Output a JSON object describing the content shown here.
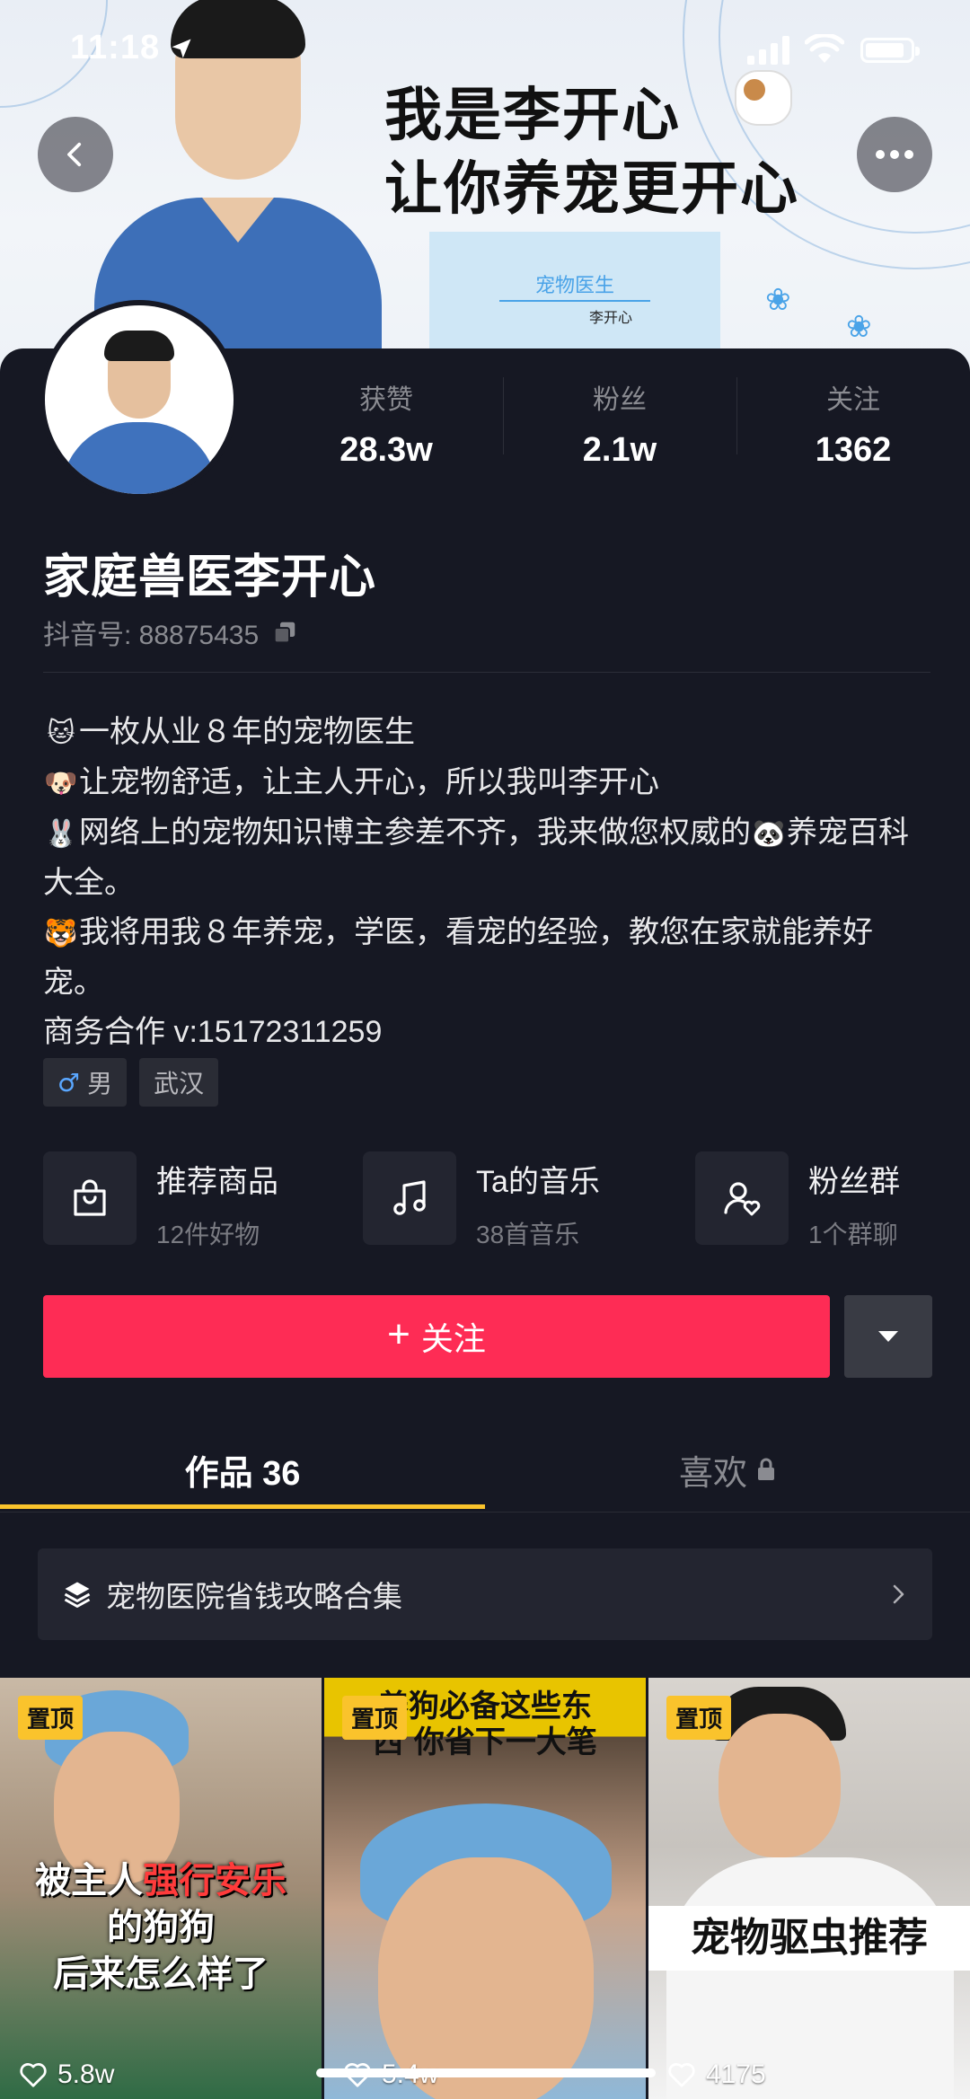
{
  "status_bar": {
    "time": "11:18"
  },
  "banner": {
    "line1": "我是李开心",
    "line2": "让你养宠更开心",
    "sign_title": "宠物医生",
    "sign_sub": "李开心"
  },
  "stats": [
    {
      "label": "获赞",
      "value": "28.3w"
    },
    {
      "label": "粉丝",
      "value": "2.1w"
    },
    {
      "label": "关注",
      "value": "1362"
    }
  ],
  "profile": {
    "name": "家庭兽医李开心",
    "douyin_id": "抖音号: 88875435"
  },
  "bio": {
    "line1": "一枚从业８年的宠物医生",
    "line2": "让宠物舒适，让主人开心，所以我叫李开心",
    "line3a": "网络上的宠物知识博主参差不齐，我来做您权威的",
    "line3b": "养宠百科大全。",
    "line4": "我将用我８年养宠，学医，看宠的经验，教您在家就能养好宠。",
    "line5": "商务合作 v:15172311259",
    "emoji": [
      "🐱",
      "🐶",
      "🐰",
      "🐼",
      "🐯"
    ]
  },
  "tags": {
    "gender": "男",
    "city": "武汉"
  },
  "features": [
    {
      "title": "推荐商品",
      "sub": "12件好物"
    },
    {
      "title": "Ta的音乐",
      "sub": "38首音乐"
    },
    {
      "title": "粉丝群",
      "sub": "1个群聊"
    }
  ],
  "actions": {
    "follow": "关注"
  },
  "tabs": {
    "works": "作品 36",
    "likes": "喜欢"
  },
  "collection": {
    "title": "宠物医院省钱攻略合集"
  },
  "videos": [
    {
      "pin": "置顶",
      "overlay_a": "被主人",
      "overlay_red": "强行安乐",
      "overlay_b": "的狗狗",
      "overlay_c": "后来怎么样了",
      "likes": "5.8w"
    },
    {
      "pin": "置顶",
      "overlay": "养狗必备这些东西 你省下一大笔",
      "likes": "5.4w"
    },
    {
      "pin": "置顶",
      "overlay": "宠物驱虫推荐",
      "likes": "4175"
    }
  ],
  "colors": {
    "accent": "#fe2c55",
    "tab_indicator": "#fac32c",
    "background": "#161823"
  }
}
